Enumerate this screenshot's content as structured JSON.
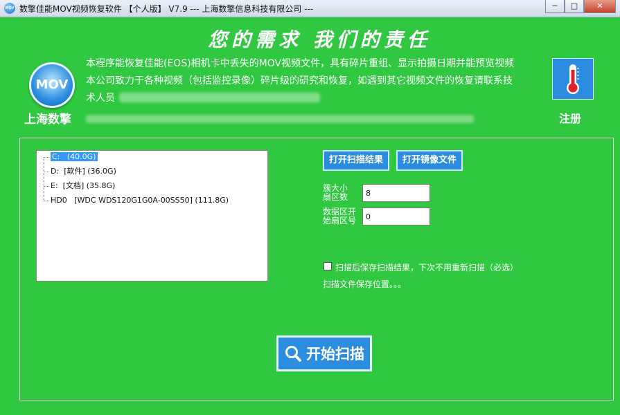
{
  "window": {
    "title": "数擎佳能MOV视频恢复软件 【个人版】 V7.9 --- 上海数擎信息科技有限公司 ---",
    "app_icon_text": "MOV",
    "buttons": {
      "minimize": "−",
      "maximize": "□",
      "close": "✕"
    }
  },
  "header": {
    "slogan": "您的需求 我们的责任",
    "logo_text": "MOV",
    "company": "上海数擎",
    "description": [
      "本程序能恢复佳能(EOS)相机卡中丢失的MOV视频文件，具有碎片重组、显示拍摄日期并能预览视频",
      "本公司致力于各种视频（包括监控录像）碎片级的研究和恢复，如遇到其它视频文件的恢复请联系技",
      "术人员"
    ],
    "register_label": "注册"
  },
  "drive_tree": {
    "items": [
      {
        "name": "C:",
        "label": "(40.0G)",
        "selected": true
      },
      {
        "name": "D:",
        "label": "[软件] (36.0G)",
        "selected": false
      },
      {
        "name": "E:",
        "label": "[文档] (35.8G)",
        "selected": false
      },
      {
        "name": "HD0",
        "label": "[WDC WDS120G1G0A-00SS50] (111.8G)",
        "selected": false
      }
    ]
  },
  "actions": {
    "open_scan_result": "打开扫描结果",
    "open_image_file": "打开镜像文件"
  },
  "fields": {
    "cluster_size": {
      "label_line1": "簇大小",
      "label_line2": "扇区数",
      "value": "8"
    },
    "data_start": {
      "label_line1": "数据区开",
      "label_line2": "始扇区号",
      "value": "0"
    }
  },
  "save_option": {
    "checkbox_label": "扫描后保存扫描结果，下次不用重新扫描（必选）",
    "checked": false,
    "location_text": "扫描文件保存位置。。。"
  },
  "scan_button": {
    "label": "开始扫描"
  },
  "colors": {
    "background": "#2fc840",
    "button": "#2c8de0",
    "thermometer": "#e0202a"
  }
}
